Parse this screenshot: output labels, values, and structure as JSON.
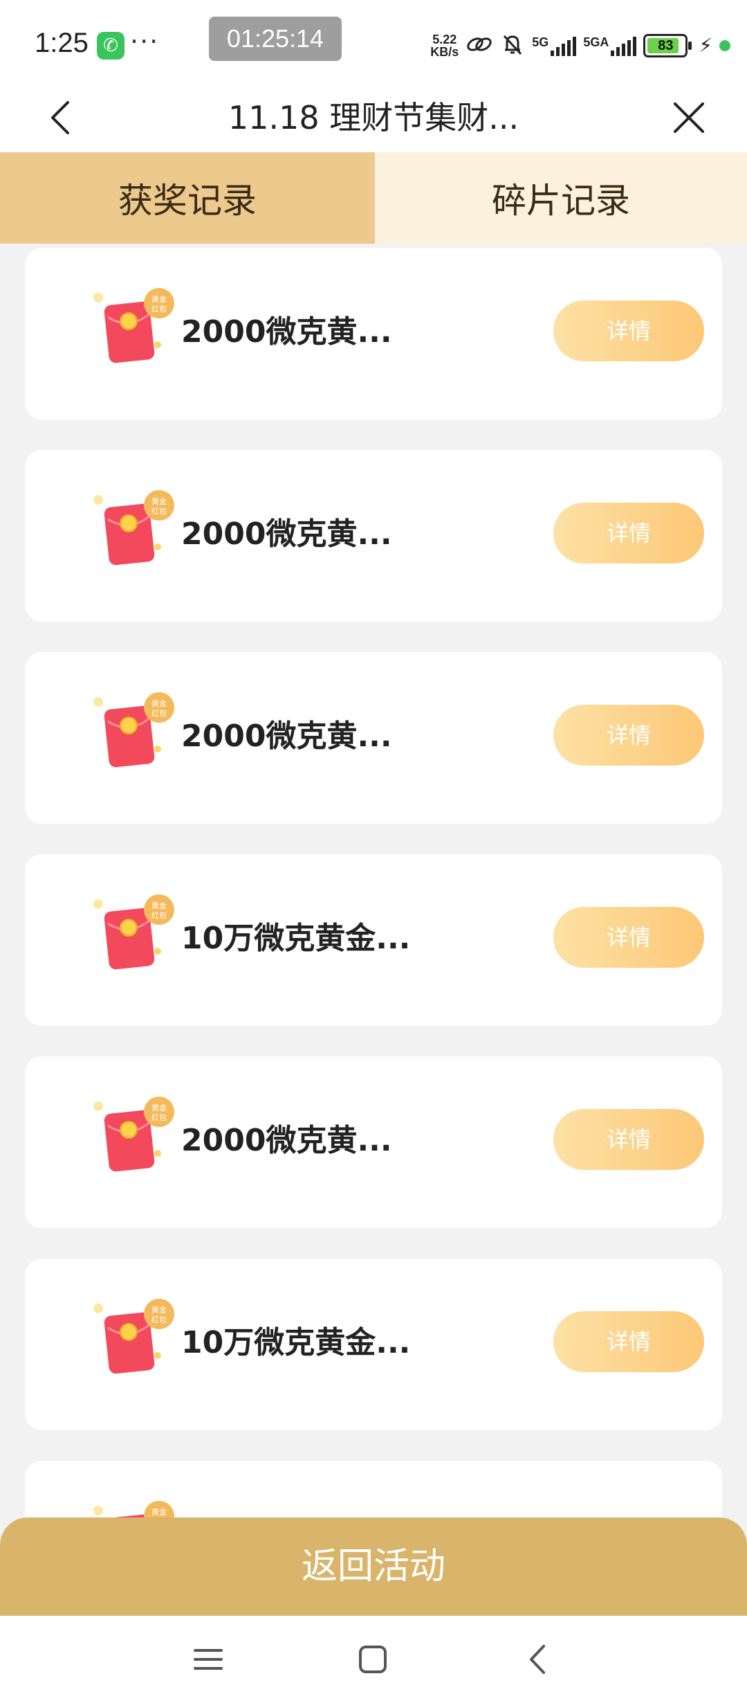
{
  "status_bar": {
    "time": "1:25",
    "screen_recorder_clock": "01:25:14",
    "net_speed_value": "5.22",
    "net_speed_unit": "KB/s",
    "signal_1_label": "5G",
    "signal_2_label": "5GA",
    "battery": "83"
  },
  "header": {
    "title": "11.18 理财节集财...",
    "back_icon": "chevron-left-icon",
    "close_icon": "close-icon"
  },
  "tabs": [
    {
      "label": "获奖记录",
      "active": true
    },
    {
      "label": "碎片记录",
      "active": false
    }
  ],
  "records": [
    {
      "badge": "黄金红包",
      "title": "2000微克黄...",
      "button": "详情"
    },
    {
      "badge": "黄金红包",
      "title": "2000微克黄...",
      "button": "详情"
    },
    {
      "badge": "黄金红包",
      "title": "2000微克黄...",
      "button": "详情"
    },
    {
      "badge": "黄金红包",
      "title": "10万微克黄金...",
      "button": "详情"
    },
    {
      "badge": "黄金红包",
      "title": "2000微克黄...",
      "button": "详情"
    },
    {
      "badge": "黄金红包",
      "title": "10万微克黄金...",
      "button": "详情"
    },
    {
      "badge": "黄金",
      "title": "",
      "button": ""
    }
  ],
  "footer": {
    "button_label": "返回活动"
  },
  "colors": {
    "tab_active_bg": "#ecc98d",
    "tab_inactive_bg": "#fbf1dc",
    "detail_button": "#fcc876",
    "footer_button": "#d9b56b",
    "red_packet": "#f24a5c"
  }
}
